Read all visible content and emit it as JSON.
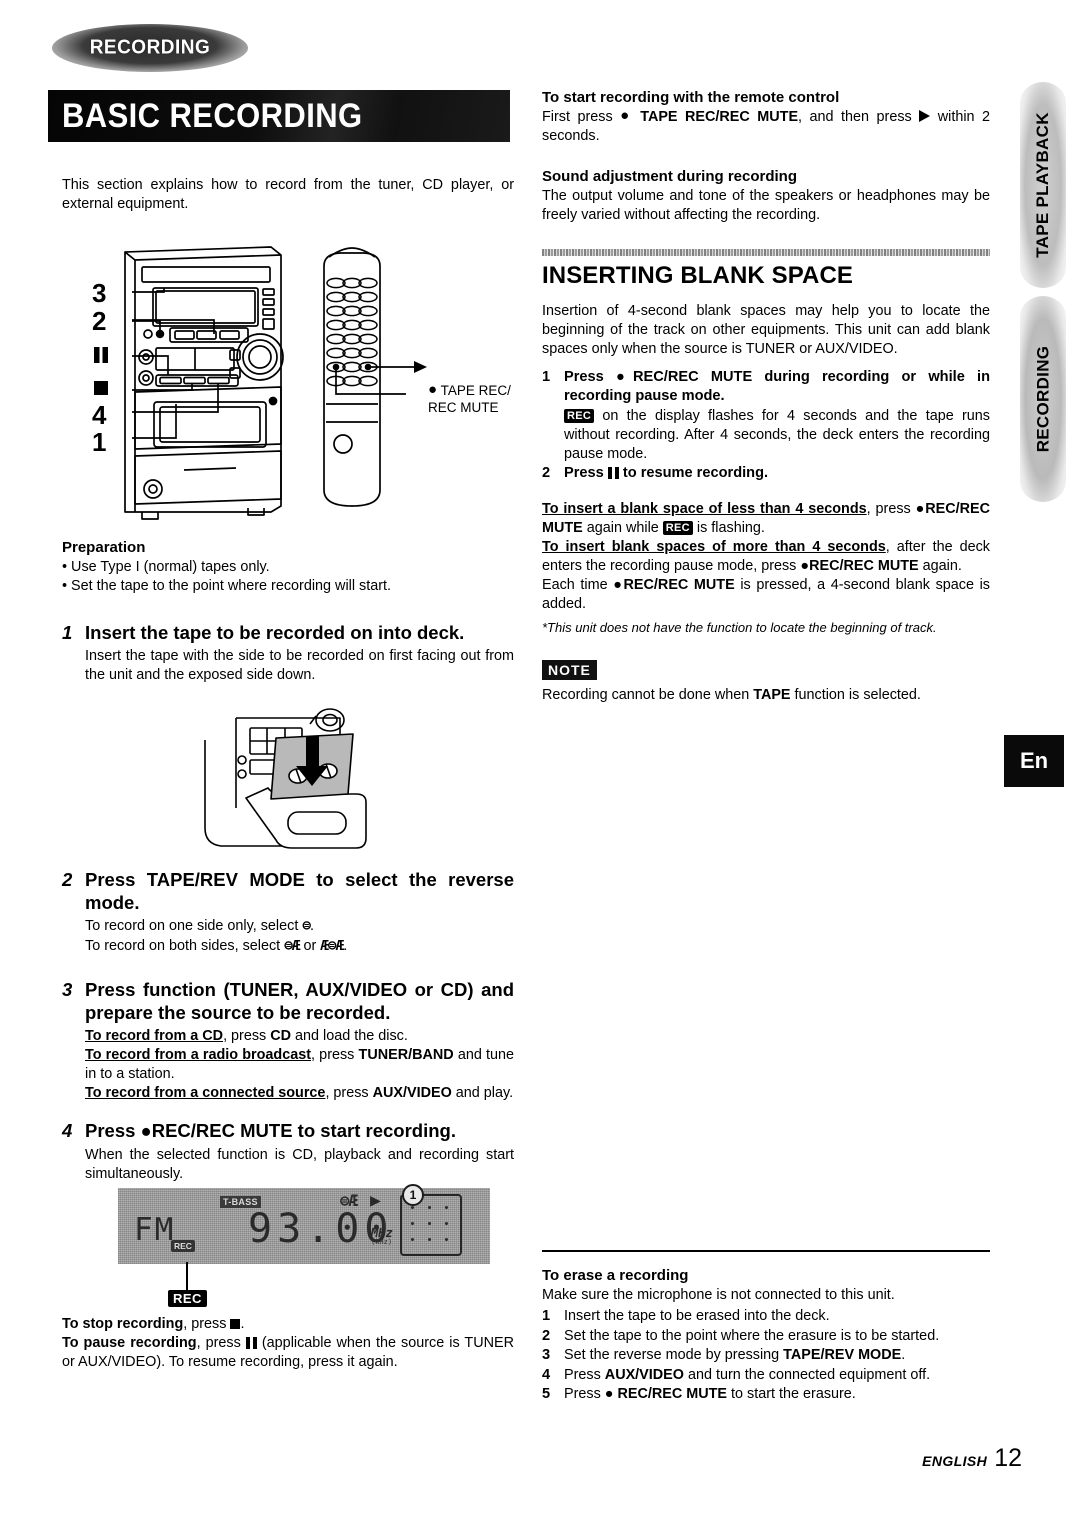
{
  "badges": {
    "section_tag": "RECORDING",
    "banner_title": "BASIC RECORDING",
    "lang_badge": "En"
  },
  "side_tabs": [
    {
      "label": "TAPE PLAYBACK",
      "name": "tab-tapeplayback"
    },
    {
      "label": "RECORDING",
      "name": "tab-recording"
    }
  ],
  "footer": {
    "language": "ENGLISH",
    "page": "12"
  },
  "left_column": {
    "intro": "This section explains how to record from the tuner, CD player, or external equipment.",
    "figure_unit": {
      "callouts": [
        "3",
        "2",
        "▮▮",
        "■",
        "4",
        "1"
      ],
      "remote_label_line1": "TAPE REC/",
      "remote_label_line2": "REC MUTE",
      "play_symbol": "▶",
      "rec_dot": "●"
    },
    "preparation": {
      "title": "Preparation",
      "bullets": [
        "Use Type I (normal) tapes only.",
        "Set the tape to the point where recording will start."
      ]
    },
    "steps": [
      {
        "num": "1",
        "head": "Insert the tape to be recorded on into deck.",
        "body": "Insert the tape with the side to be recorded on first facing out from the unit and the exposed side down."
      },
      {
        "num": "2",
        "head_line1": "Press TAPE/REV MODE to select the reverse",
        "head_line2": "mode.",
        "body_line1": "To record on one side only, select ⊅.",
        "body_line2": "To record on both sides, select ⊅Ɔ or Ɔ⊅Ɔ."
      },
      {
        "num": "3",
        "head_line1": "Press function (TUNER, AUX/VIDEO  or CD) and",
        "head_line2": "prepare the source to be recorded.",
        "lines": [
          {
            "lead": "To record from a CD",
            "rest": ", press ",
            "strong": "CD",
            "tail": " and load the disc."
          },
          {
            "lead": "To record from a radio broadcast",
            "rest": ", press ",
            "strong": "TUNER/BAND",
            "tail": " and tune in to a station."
          },
          {
            "lead": "To record from a connected source",
            "rest": ", press ",
            "strong": "AUX/VIDEO",
            "tail": " and play."
          }
        ]
      },
      {
        "num": "4",
        "head": "Press ●REC/REC MUTE to start recording.",
        "body": "When the selected function is CD, playback and recording start simultaneously."
      }
    ],
    "lcd": {
      "band": "FM",
      "frequency": "93.00",
      "unit": "MHz",
      "unit_sub": "(kHz)",
      "tbass": "T-BASS",
      "rec_indicator": "REC",
      "preset": "1",
      "callout_rec": "REC"
    },
    "stop_pause": {
      "stop_lead": "To stop recording",
      "stop_rest": ", press ",
      "stop_tail": ".",
      "pause_lead": "To pause recording",
      "pause_rest": ", press ",
      "pause_tail": " (applicable when the source is TUNER or AUX/VIDEO). To resume recording, press it again."
    }
  },
  "right_column": {
    "remote_start": {
      "title": "To start recording with the remote control",
      "body_pre": "First press ",
      "body_bold": "TAPE REC/REC MUTE",
      "body_mid": ", and then press ",
      "body_post": " within 2 seconds."
    },
    "sound_adjustment": {
      "title": "Sound adjustment during recording",
      "body": "The output volume and tone of the speakers or headphones may be freely varied without affecting the recording."
    },
    "inserting_blank_space": {
      "heading": "INSERTING BLANK SPACE",
      "intro": "Insertion of 4-second blank spaces may help you to locate the beginning of the track on other equipments. This unit can add blank spaces only when the source is TUNER or AUX/VIDEO.",
      "steps": [
        {
          "num": "1",
          "head_line1": "Press ●REC/REC MUTE during recording or while in",
          "head_line2": "recording pause mode.",
          "body_post": " on the display flashes for 4 seconds and the tape runs without recording. After 4 seconds, the deck enters the recording pause mode."
        },
        {
          "num": "2",
          "head": "Press ❚❚ to resume recording."
        }
      ],
      "notes": [
        {
          "lead": "To insert a blank space of less than 4 seconds",
          "mid": ", press ",
          "bold": "●REC/REC MUTE",
          "mid2": " again while ",
          "tail": " is flashing."
        },
        {
          "lead": "To insert blank spaces of more than 4 seconds",
          "mid": ", after the deck enters the recording pause mode, press ",
          "bold": "●REC/REC MUTE",
          "tail2": " again."
        },
        {
          "plain_pre": "Each time ",
          "bold": "●REC/REC MUTE",
          "plain_post": " is pressed, a 4-second blank space is added."
        }
      ],
      "footnote": "*This unit does not have the function to locate the beginning of track.",
      "note_badge": "NOTE",
      "note_pre": "Recording cannot be done when ",
      "note_bold": "TAPE",
      "note_post": " function is selected."
    },
    "erase": {
      "title": "To erase a recording",
      "intro": "Make sure the microphone is not connected to this unit.",
      "steps": [
        {
          "num": "1",
          "pre": "Insert the tape to be erased into the deck.",
          "bold": "",
          "post": ""
        },
        {
          "num": "2",
          "pre": "Set the tape to the point where the erasure is to be started.",
          "bold": "",
          "post": ""
        },
        {
          "num": "3",
          "pre": "Set the reverse mode by pressing ",
          "bold": "TAPE/REV MODE",
          "post": "."
        },
        {
          "num": "4",
          "pre": "Press ",
          "bold": "AUX/VIDEO",
          "post": " and turn the connected equipment off."
        },
        {
          "num": "5",
          "pre": "Press ● ",
          "bold": "REC/REC MUTE",
          "post": " to start the erasure."
        }
      ]
    }
  }
}
